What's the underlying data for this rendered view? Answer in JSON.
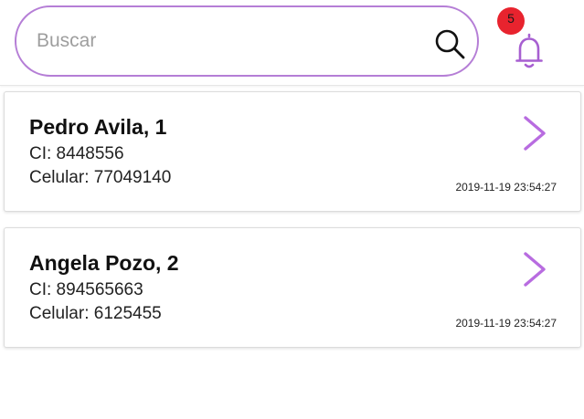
{
  "search": {
    "placeholder": "Buscar",
    "value": ""
  },
  "notifications": {
    "count": "5",
    "badge_color": "#e8232e",
    "icon": "bell-icon"
  },
  "colors": {
    "accent": "#b57ed6",
    "chevron": "#b86ce0"
  },
  "patients": [
    {
      "name": "Pedro Avila, 1",
      "ci": "CI: 8448556",
      "phone": "Celular: 77049140",
      "date": "2019-11-19 23:54:27"
    },
    {
      "name": "Angela Pozo, 2",
      "ci": "CI: 894565663",
      "phone": "Celular: 6125455",
      "date": "2019-11-19 23:54:27"
    }
  ]
}
